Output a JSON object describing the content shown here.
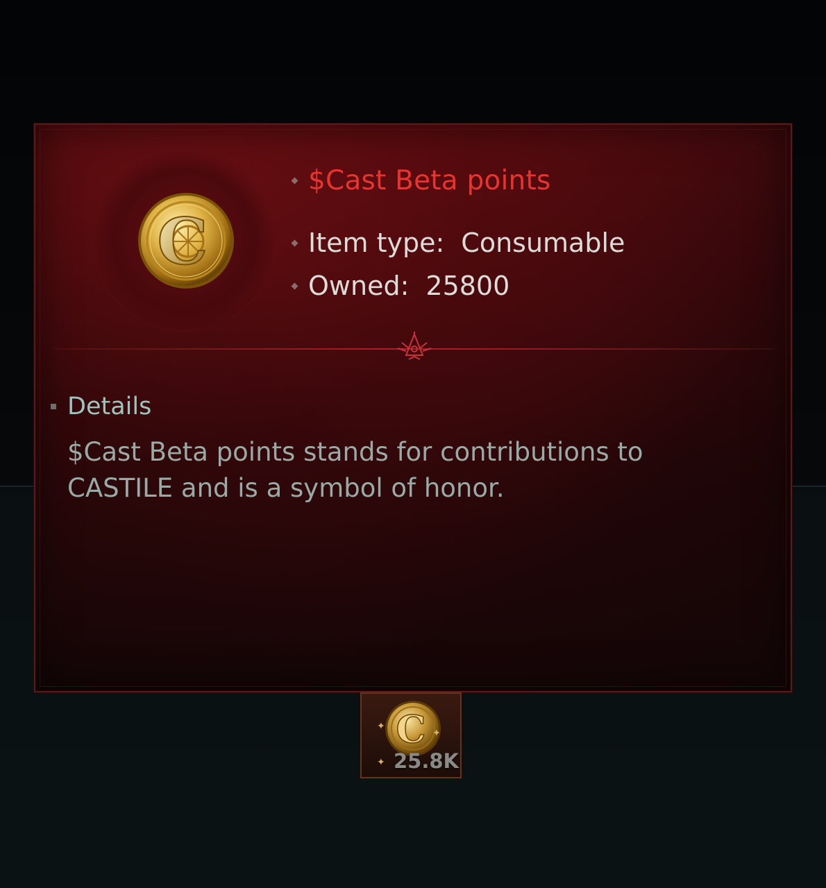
{
  "tooltip": {
    "item_name": "$Cast Beta points",
    "fields": [
      {
        "label": "Item type:",
        "value": "Consumable"
      },
      {
        "label": "Owned:",
        "value": "25800"
      }
    ],
    "details_title": "Details",
    "details_text": "$Cast Beta points stands for contributions to CASTILE and is a symbol of honor.",
    "coin_letter": "C"
  },
  "inventory_slot": {
    "count": "25.8K",
    "coin_letter": "C"
  },
  "colors": {
    "title_red": "#e8332f",
    "label_white": "#dcdcd8",
    "details_teal": "#9ec4bd",
    "body_gray": "#9aaaa6",
    "gold": "#d7b36a"
  },
  "icons": {
    "item": "gold-c-coin-icon",
    "divider_emblem": "castile-emblem-icon"
  }
}
